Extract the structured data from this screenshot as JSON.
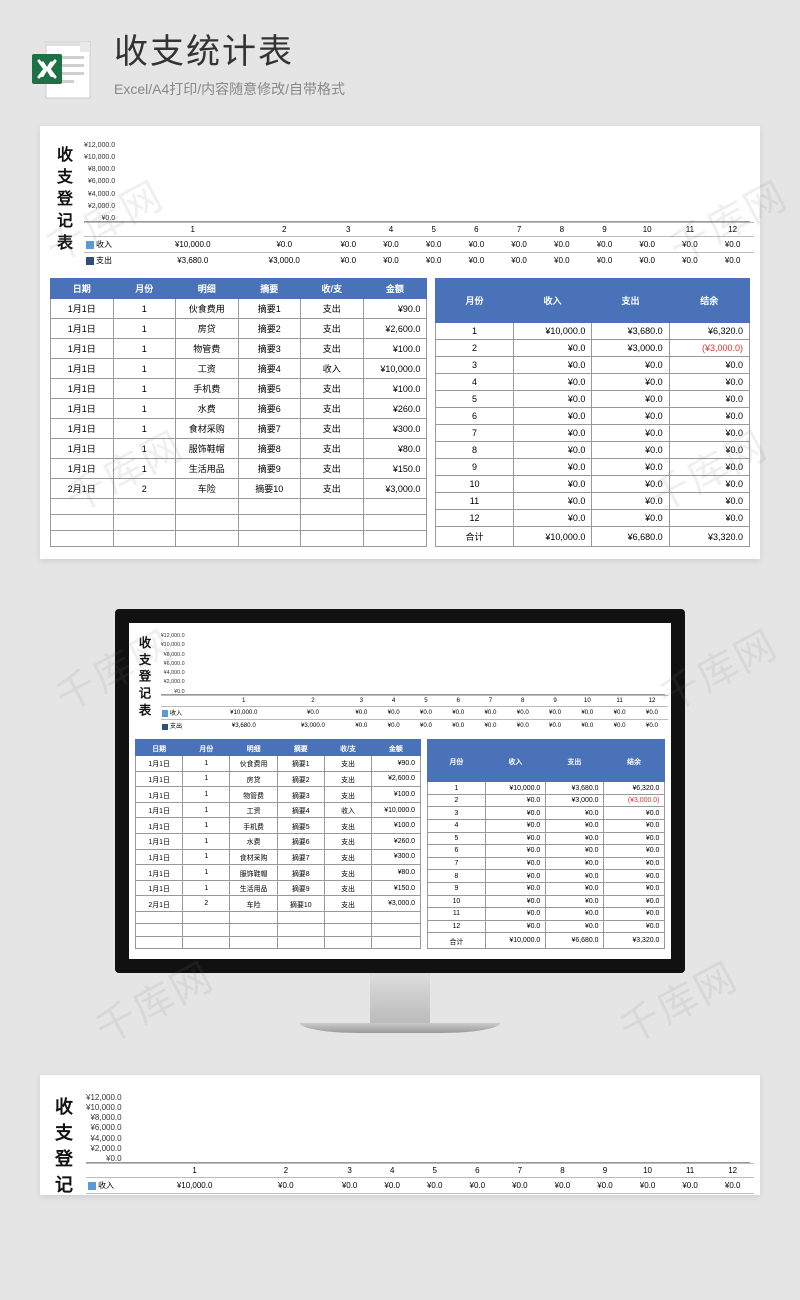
{
  "header": {
    "title": "收支统计表",
    "subtitle": "Excel/A4打印/内容随意修改/自带格式"
  },
  "sheet": {
    "vertical_title": "收支登记表",
    "vertical_title_short": "收支登记"
  },
  "watermark": "千库网",
  "legend": {
    "income": "收入",
    "expend": "支出"
  },
  "chart_data": {
    "type": "bar",
    "title": "",
    "xlabel": "",
    "ylabel": "",
    "ylim": [
      0,
      12000
    ],
    "yticks": [
      "¥0.0",
      "¥2,000.0",
      "¥4,000.0",
      "¥6,000.0",
      "¥8,000.0",
      "¥10,000.0",
      "¥12,000.0"
    ],
    "categories": [
      "1",
      "2",
      "3",
      "4",
      "5",
      "6",
      "7",
      "8",
      "9",
      "10",
      "11",
      "12"
    ],
    "series": [
      {
        "name": "收入",
        "values": [
          10000,
          0,
          0,
          0,
          0,
          0,
          0,
          0,
          0,
          0,
          0,
          0
        ],
        "display": [
          "¥10,000.0",
          "¥0.0",
          "¥0.0",
          "¥0.0",
          "¥0.0",
          "¥0.0",
          "¥0.0",
          "¥0.0",
          "¥0.0",
          "¥0.0",
          "¥0.0",
          "¥0.0"
        ]
      },
      {
        "name": "支出",
        "values": [
          3680,
          3000,
          0,
          0,
          0,
          0,
          0,
          0,
          0,
          0,
          0,
          0
        ],
        "display": [
          "¥3,680.0",
          "¥3,000.0",
          "¥0.0",
          "¥0.0",
          "¥0.0",
          "¥0.0",
          "¥0.0",
          "¥0.0",
          "¥0.0",
          "¥0.0",
          "¥0.0",
          "¥0.0"
        ]
      }
    ]
  },
  "left_table": {
    "headers": [
      "日期",
      "月份",
      "明细",
      "摘要",
      "收/支",
      "金额"
    ],
    "rows": [
      [
        "1月1日",
        "1",
        "伙食费用",
        "摘要1",
        "支出",
        "¥90.0"
      ],
      [
        "1月1日",
        "1",
        "房贷",
        "摘要2",
        "支出",
        "¥2,600.0"
      ],
      [
        "1月1日",
        "1",
        "物管费",
        "摘要3",
        "支出",
        "¥100.0"
      ],
      [
        "1月1日",
        "1",
        "工资",
        "摘要4",
        "收入",
        "¥10,000.0"
      ],
      [
        "1月1日",
        "1",
        "手机费",
        "摘要5",
        "支出",
        "¥100.0"
      ],
      [
        "1月1日",
        "1",
        "水费",
        "摘要6",
        "支出",
        "¥260.0"
      ],
      [
        "1月1日",
        "1",
        "食材采购",
        "摘要7",
        "支出",
        "¥300.0"
      ],
      [
        "1月1日",
        "1",
        "服饰鞋帽",
        "摘要8",
        "支出",
        "¥80.0"
      ],
      [
        "1月1日",
        "1",
        "生活用品",
        "摘要9",
        "支出",
        "¥150.0"
      ],
      [
        "2月1日",
        "2",
        "车险",
        "摘要10",
        "支出",
        "¥3,000.0"
      ],
      [
        "",
        "",
        "",
        "",
        "",
        ""
      ],
      [
        "",
        "",
        "",
        "",
        "",
        ""
      ],
      [
        "",
        "",
        "",
        "",
        "",
        ""
      ]
    ]
  },
  "right_table": {
    "headers": [
      "月份",
      "收入",
      "支出",
      "结余"
    ],
    "rows": [
      [
        "1",
        "¥10,000.0",
        "¥3,680.0",
        "¥6,320.0",
        false
      ],
      [
        "2",
        "¥0.0",
        "¥3,000.0",
        "(¥3,000.0)",
        true
      ],
      [
        "3",
        "¥0.0",
        "¥0.0",
        "¥0.0",
        false
      ],
      [
        "4",
        "¥0.0",
        "¥0.0",
        "¥0.0",
        false
      ],
      [
        "5",
        "¥0.0",
        "¥0.0",
        "¥0.0",
        false
      ],
      [
        "6",
        "¥0.0",
        "¥0.0",
        "¥0.0",
        false
      ],
      [
        "7",
        "¥0.0",
        "¥0.0",
        "¥0.0",
        false
      ],
      [
        "8",
        "¥0.0",
        "¥0.0",
        "¥0.0",
        false
      ],
      [
        "9",
        "¥0.0",
        "¥0.0",
        "¥0.0",
        false
      ],
      [
        "10",
        "¥0.0",
        "¥0.0",
        "¥0.0",
        false
      ],
      [
        "11",
        "¥0.0",
        "¥0.0",
        "¥0.0",
        false
      ],
      [
        "12",
        "¥0.0",
        "¥0.0",
        "¥0.0",
        false
      ],
      [
        "合计",
        "¥10,000.0",
        "¥6,680.0",
        "¥3,320.0",
        false
      ]
    ]
  }
}
